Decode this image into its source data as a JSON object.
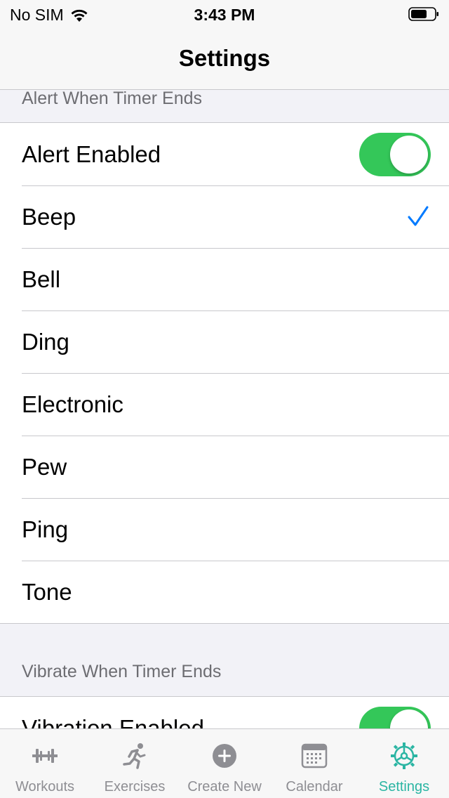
{
  "status_bar": {
    "carrier": "No SIM",
    "time": "3:43 PM"
  },
  "nav": {
    "title": "Settings"
  },
  "sections": [
    {
      "header": "Alert When Timer Ends",
      "toggle_label": "Alert Enabled",
      "toggle_on": true,
      "sounds": [
        "Beep",
        "Bell",
        "Ding",
        "Electronic",
        "Pew",
        "Ping",
        "Tone"
      ],
      "selected_sound": "Beep"
    },
    {
      "header": "Vibrate When Timer Ends",
      "toggle_label": "Vibration Enabled",
      "toggle_on": true
    }
  ],
  "tabs": [
    {
      "label": "Workouts",
      "icon": "barbell-icon"
    },
    {
      "label": "Exercises",
      "icon": "running-man-icon"
    },
    {
      "label": "Create New",
      "icon": "plus-circle-icon"
    },
    {
      "label": "Calendar",
      "icon": "calendar-icon"
    },
    {
      "label": "Settings",
      "icon": "gear-icon",
      "active": true
    }
  ],
  "colors": {
    "toggle_on": "#34c759",
    "checkmark": "#007aff",
    "tab_active": "#2bb5a3",
    "tab_inactive": "#8e8e93"
  }
}
